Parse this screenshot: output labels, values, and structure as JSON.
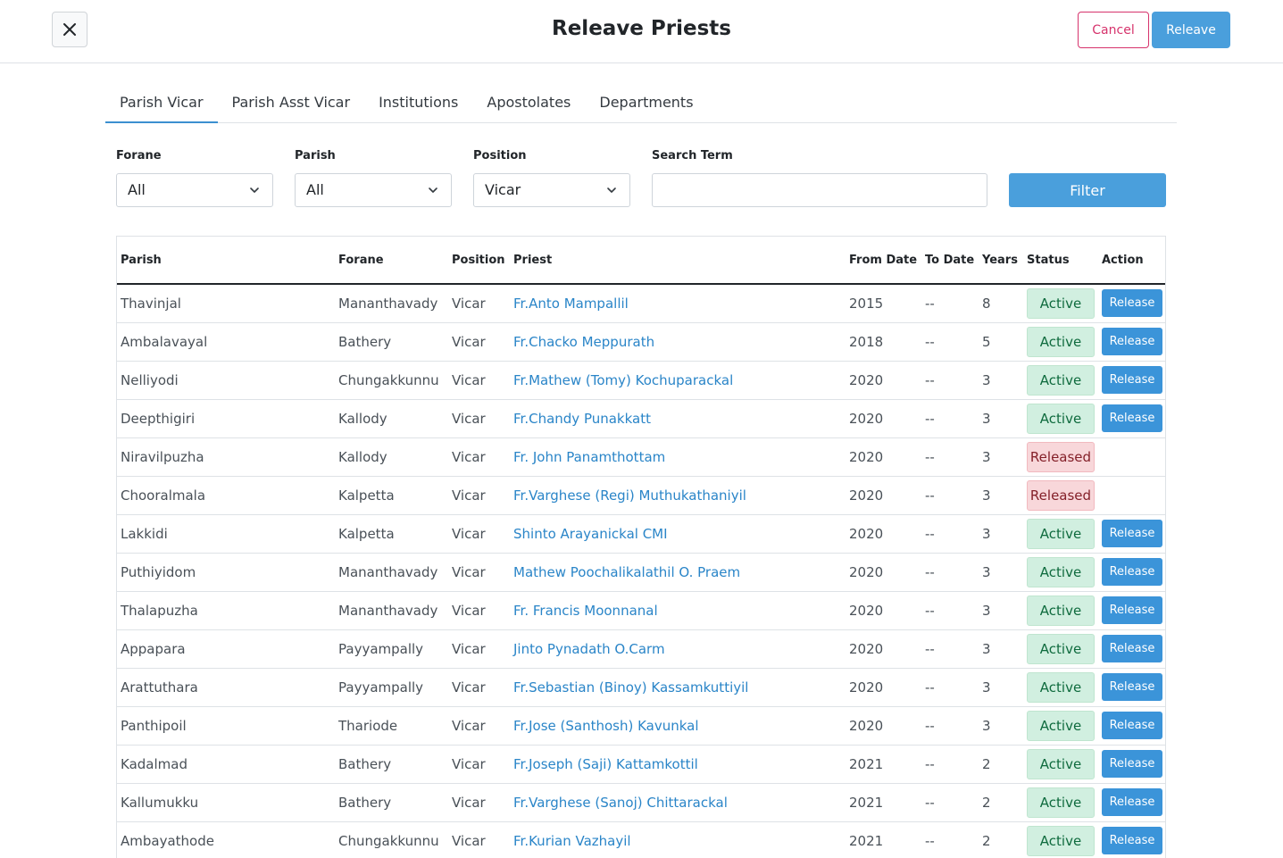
{
  "header": {
    "title": "Releave Priests",
    "cancel_label": "Cancel",
    "releave_label": "Releave"
  },
  "tabs": [
    {
      "label": "Parish Vicar",
      "active": true
    },
    {
      "label": "Parish Asst Vicar"
    },
    {
      "label": "Institutions"
    },
    {
      "label": "Apostolates"
    },
    {
      "label": "Departments"
    }
  ],
  "filters": {
    "forane": {
      "label": "Forane",
      "value": "All"
    },
    "parish": {
      "label": "Parish",
      "value": "All"
    },
    "position": {
      "label": "Position",
      "value": "Vicar"
    },
    "search": {
      "label": "Search Term",
      "value": "",
      "placeholder": ""
    },
    "filter_label": "Filter"
  },
  "table": {
    "columns": [
      "Parish",
      "Forane",
      "Position",
      "Priest",
      "From Date",
      "To Date",
      "Years",
      "Status",
      "Action"
    ],
    "release_label": "Release",
    "rows": [
      {
        "parish": "Thavinjal",
        "forane": "Mananthavady",
        "position": "Vicar",
        "priest": "Fr.Anto Mampallil",
        "from": "2015",
        "to": "--",
        "years": "8",
        "status": "Active"
      },
      {
        "parish": "Ambalavayal",
        "forane": "Bathery",
        "position": "Vicar",
        "priest": "Fr.Chacko Meppurath",
        "from": "2018",
        "to": "--",
        "years": "5",
        "status": "Active"
      },
      {
        "parish": "Nelliyodi",
        "forane": "Chungakkunnu",
        "position": "Vicar",
        "priest": "Fr.Mathew (Tomy) Kochuparackal",
        "from": "2020",
        "to": "--",
        "years": "3",
        "status": "Active"
      },
      {
        "parish": "Deepthigiri",
        "forane": "Kallody",
        "position": "Vicar",
        "priest": "Fr.Chandy Punakkatt",
        "from": "2020",
        "to": "--",
        "years": "3",
        "status": "Active"
      },
      {
        "parish": "Niravilpuzha",
        "forane": "Kallody",
        "position": "Vicar",
        "priest": "Fr. John Panamthottam",
        "from": "2020",
        "to": "--",
        "years": "3",
        "status": "Released"
      },
      {
        "parish": "Chooralmala",
        "forane": "Kalpetta",
        "position": "Vicar",
        "priest": "Fr.Varghese (Regi) Muthukathaniyil",
        "from": "2020",
        "to": "--",
        "years": "3",
        "status": "Released"
      },
      {
        "parish": "Lakkidi",
        "forane": "Kalpetta",
        "position": "Vicar",
        "priest": "Shinto Arayanickal CMI",
        "from": "2020",
        "to": "--",
        "years": "3",
        "status": "Active"
      },
      {
        "parish": "Puthiyidom",
        "forane": "Mananthavady",
        "position": "Vicar",
        "priest": "Mathew Poochalikalathil O. Praem",
        "from": "2020",
        "to": "--",
        "years": "3",
        "status": "Active"
      },
      {
        "parish": "Thalapuzha",
        "forane": "Mananthavady",
        "position": "Vicar",
        "priest": "Fr. Francis Moonnanal",
        "from": "2020",
        "to": "--",
        "years": "3",
        "status": "Active"
      },
      {
        "parish": "Appapara",
        "forane": "Payyampally",
        "position": "Vicar",
        "priest": "Jinto Pynadath O.Carm",
        "from": "2020",
        "to": "--",
        "years": "3",
        "status": "Active"
      },
      {
        "parish": "Arattuthara",
        "forane": "Payyampally",
        "position": "Vicar",
        "priest": "Fr.Sebastian (Binoy) Kassamkuttiyil",
        "from": "2020",
        "to": "--",
        "years": "3",
        "status": "Active"
      },
      {
        "parish": "Panthipoil",
        "forane": "Thariode",
        "position": "Vicar",
        "priest": "Fr.Jose (Santhosh) Kavunkal",
        "from": "2020",
        "to": "--",
        "years": "3",
        "status": "Active"
      },
      {
        "parish": "Kadalmad",
        "forane": "Bathery",
        "position": "Vicar",
        "priest": "Fr.Joseph (Saji) Kattamkottil",
        "from": "2021",
        "to": "--",
        "years": "2",
        "status": "Active"
      },
      {
        "parish": "Kallumukku",
        "forane": "Bathery",
        "position": "Vicar",
        "priest": "Fr.Varghese (Sanoj) Chittarackal",
        "from": "2021",
        "to": "--",
        "years": "2",
        "status": "Active"
      },
      {
        "parish": "Ambayathode",
        "forane": "Chungakkunnu",
        "position": "Vicar",
        "priest": "Fr.Kurian Vazhayil",
        "from": "2021",
        "to": "--",
        "years": "2",
        "status": "Active"
      }
    ]
  }
}
